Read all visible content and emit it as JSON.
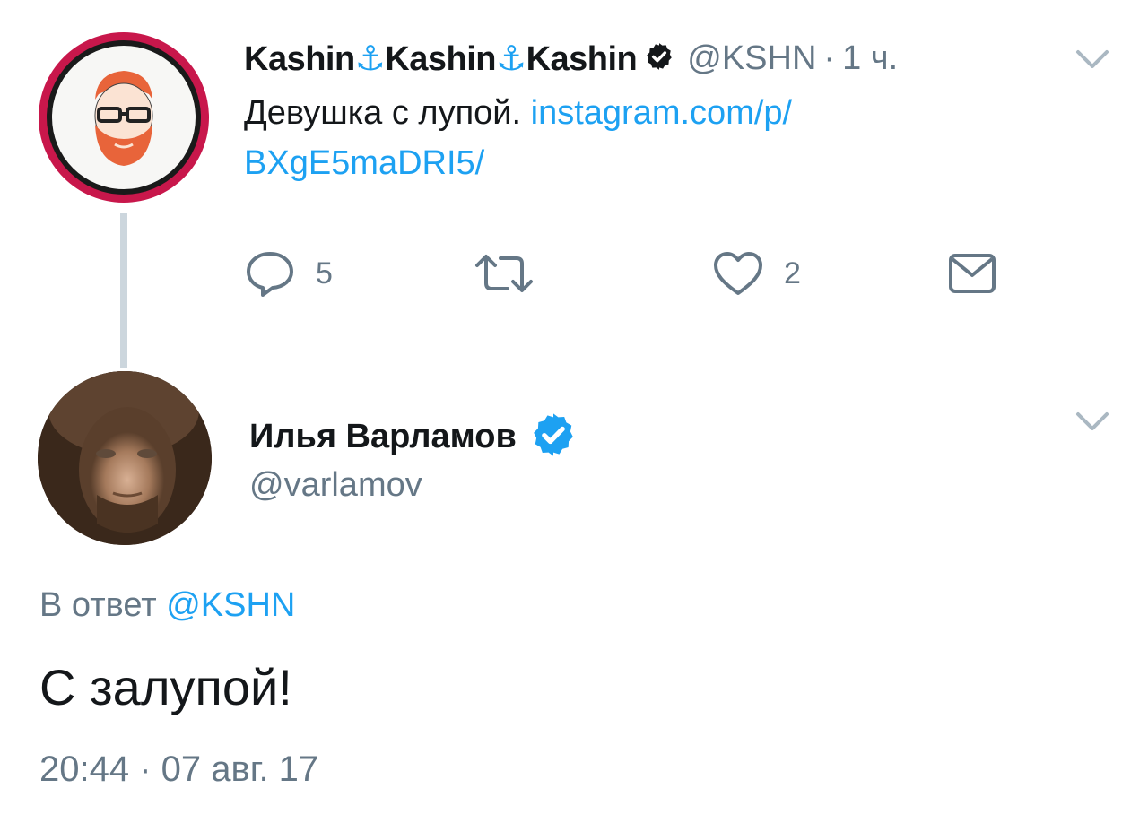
{
  "parent_tweet": {
    "name_part": "Kashin",
    "anchor_glyph": "⚓",
    "handle": "@KSHN",
    "separator": "·",
    "time": "1 ч.",
    "text": "Девушка с лупой.",
    "link_line1": "instagram.com/p/",
    "link_line2": "BXgE5maDRI5/",
    "actions": {
      "reply_icon": "reply-icon",
      "reply_count": "5",
      "retweet_icon": "retweet-icon",
      "like_icon": "heart-icon",
      "like_count": "2",
      "dm_icon": "envelope-icon"
    }
  },
  "reply_tweet": {
    "name": "Илья Варламов",
    "handle": "@varlamov",
    "reply_prefix": "В ответ",
    "reply_to": "@KSHN",
    "text": "С залупой!",
    "timestamp": "20:44 · 07 авг. 17"
  },
  "colors": {
    "accent": "#1da1f2",
    "secondary_text": "#657786",
    "primary_text": "#14171a",
    "thread_line": "#ccd6dd",
    "avatar_ring": "#c8174b"
  }
}
